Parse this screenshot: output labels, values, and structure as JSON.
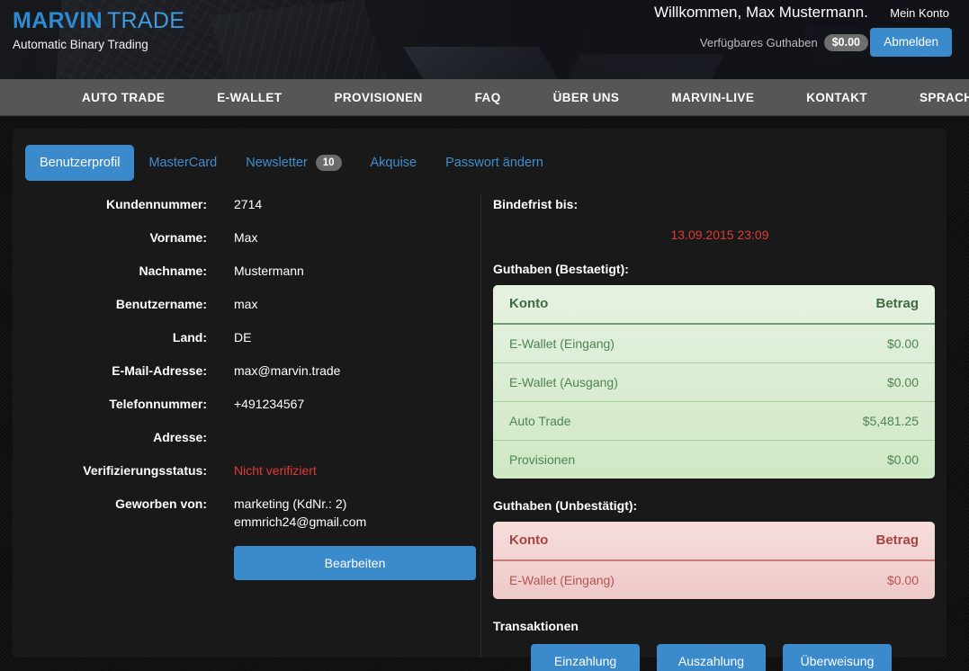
{
  "header": {
    "brand_primary": "MARVIN",
    "brand_secondary": "TRADE",
    "tagline": "Automatic Binary Trading",
    "welcome": "Willkommen, Max Mustermann.",
    "balance_label": "Verfügbares Guthaben",
    "balance_value": "$0.00",
    "account_link": "Mein Konto",
    "logout_label": "Abmelden",
    "brand_color": "#2e8ad1",
    "accent_color": "#3b8bcc"
  },
  "nav": {
    "items": [
      {
        "label": "AUTO TRADE"
      },
      {
        "label": "E-WALLET"
      },
      {
        "label": "PROVISIONEN"
      },
      {
        "label": "FAQ"
      },
      {
        "label": "ÜBER UNS"
      },
      {
        "label": "MARVIN-LIVE"
      },
      {
        "label": "KONTAKT"
      },
      {
        "label": "SPRACHE"
      }
    ]
  },
  "tabs": [
    {
      "label": "Benutzerprofil",
      "active": true
    },
    {
      "label": "MasterCard",
      "active": false
    },
    {
      "label": "Newsletter",
      "badge": "10",
      "active": false
    },
    {
      "label": "Akquise",
      "active": false
    },
    {
      "label": "Passwort ändern",
      "active": false
    }
  ],
  "profile": {
    "rows": [
      {
        "label": "Kundennummer:",
        "value": "2714"
      },
      {
        "label": "Vorname:",
        "value": "Max"
      },
      {
        "label": "Nachname:",
        "value": "Mustermann"
      },
      {
        "label": "Benutzername:",
        "value": "max"
      },
      {
        "label": "Land:",
        "value": "DE"
      },
      {
        "label": "E-Mail-Adresse:",
        "value": "max@marvin.trade"
      },
      {
        "label": "Telefonnummer:",
        "value": "+491234567"
      },
      {
        "label": "Adresse:",
        "value": ""
      },
      {
        "label": "Verifizierungsstatus:",
        "value": "Nicht verifiziert",
        "color": "#e03b32"
      }
    ],
    "referrer_label": "Geworben von:",
    "referrer_line1": "marketing (KdNr.: 2)",
    "referrer_line2": "emmrich24@gmail.com",
    "edit_button": "Bearbeiten"
  },
  "sidebar_right": {
    "bindefrist_label": "Bindefrist bis:",
    "bindefrist_value": "13.09.2015 23:09",
    "confirmed_label": "Guthaben (Bestaetigt):",
    "confirmed_table": {
      "col_account": "Konto",
      "col_amount": "Betrag",
      "rows": [
        {
          "account": "E-Wallet (Eingang)",
          "amount": "$0.00"
        },
        {
          "account": "E-Wallet (Ausgang)",
          "amount": "$0.00"
        },
        {
          "account": "Auto Trade",
          "amount": "$5,481.25"
        },
        {
          "account": "Provisionen",
          "amount": "$0.00"
        }
      ]
    },
    "unconfirmed_label": "Guthaben (Unbestätigt):",
    "unconfirmed_table": {
      "col_account": "Konto",
      "col_amount": "Betrag",
      "rows": [
        {
          "account": "E-Wallet (Eingang)",
          "amount": "$0.00"
        }
      ]
    },
    "transactions_label": "Transaktionen",
    "transaction_buttons": [
      {
        "label": "Einzahlung"
      },
      {
        "label": "Auszahlung"
      },
      {
        "label": "Überweisung"
      }
    ]
  }
}
